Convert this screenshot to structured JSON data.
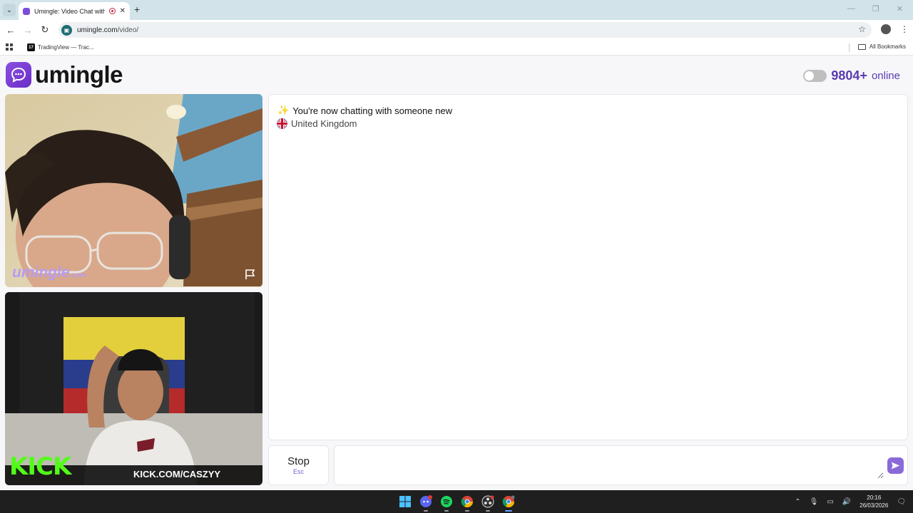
{
  "browser": {
    "tab_title": "Umingle: Video Chat with S",
    "url_host": "umingle.com",
    "url_path": "/video/",
    "bookmarks": [
      {
        "label": "TradingView — Trac..."
      }
    ],
    "all_bookmarks_label": "All Bookmarks"
  },
  "site": {
    "logo_text": "umingle",
    "online_count": "9804+",
    "online_label": "online"
  },
  "videos": {
    "top_watermark": "umingle",
    "top_watermark_suffix": ".com",
    "bottom_overlay_logo": "KICK",
    "bottom_overlay_url": "KICK.COM/CASZYY"
  },
  "chat": {
    "system_message": "You're now chatting with someone new",
    "country": "United Kingdom",
    "stop_label": "Stop",
    "stop_shortcut": "Esc",
    "input_value": "",
    "input_placeholder": ""
  },
  "taskbar": {
    "time": "20:16",
    "date": "26/03/2026",
    "apps": [
      "windows-start",
      "discord",
      "spotify",
      "chrome",
      "obs",
      "chrome-profile"
    ]
  },
  "colors": {
    "brand_purple": "#6a2ec8",
    "online_purple": "#5a3bb0",
    "kick_green": "#53fc18"
  }
}
